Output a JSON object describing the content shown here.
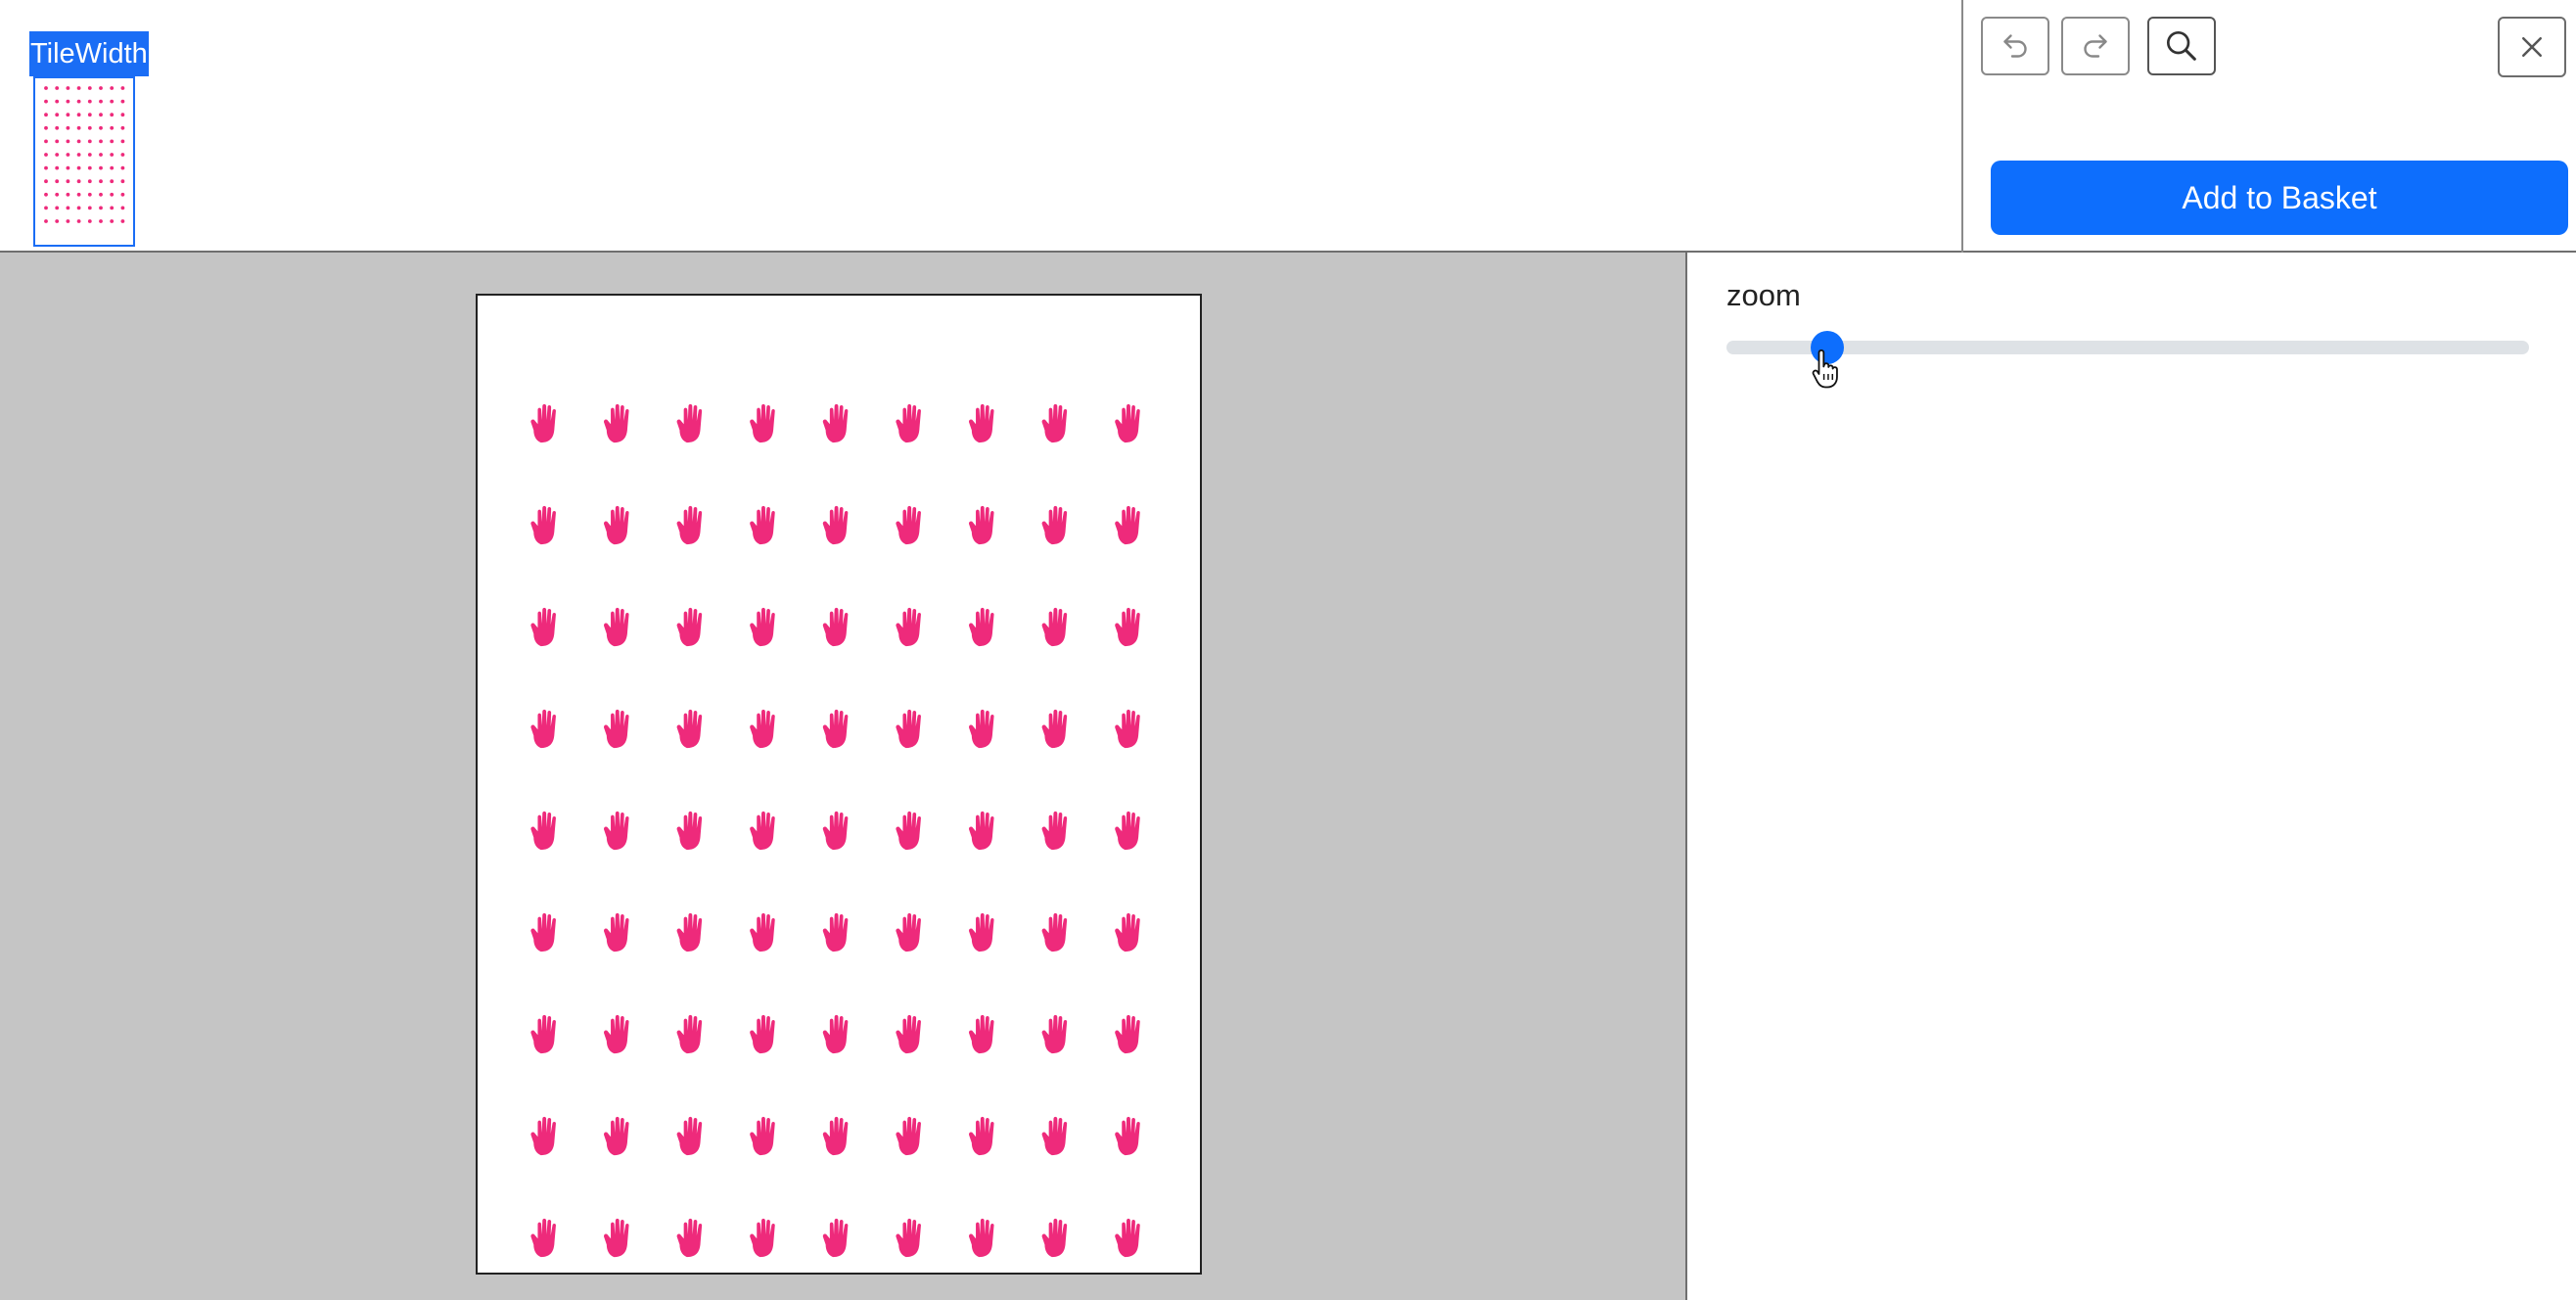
{
  "tile": {
    "label": "TileWidth"
  },
  "toolbar": {
    "undo_icon": "undo-icon",
    "redo_icon": "redo-icon",
    "search_icon": "search-icon",
    "close_icon": "close-icon",
    "basket_label": "Add to Basket"
  },
  "zoom": {
    "label": "zoom",
    "value": 0.11
  },
  "pattern": {
    "icon": "hand-icon",
    "color": "#ee2a7b",
    "rows": 9,
    "cols": 9
  },
  "colors": {
    "accent": "#0d6efd",
    "canvas_bg": "#c5c5c5",
    "pattern": "#ee2a7b"
  }
}
